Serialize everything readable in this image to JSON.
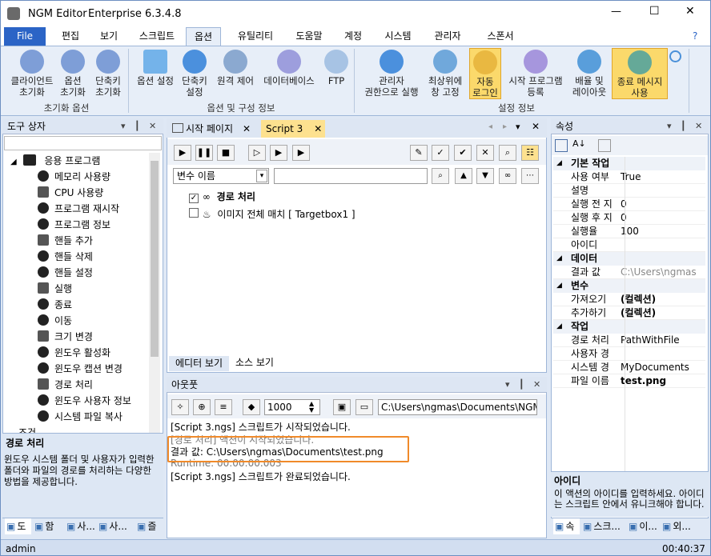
{
  "window": {
    "app_name": "NGM Editor",
    "edition": "Enterprise 6.3.4.8",
    "min": "—",
    "max": "☐",
    "close": "✕"
  },
  "menu": {
    "file": "File",
    "tabs": [
      "편집",
      "보기",
      "스크립트",
      "옵션",
      "유틸리티",
      "도움말",
      "계정",
      "시스템",
      "관리자",
      "스폰서"
    ]
  },
  "ribbon": {
    "init": [
      {
        "l1": "클라이언트",
        "l2": "초기화"
      },
      {
        "l1": "옵션",
        "l2": "초기화"
      },
      {
        "l1": "단축키",
        "l2": "초기화"
      }
    ],
    "options": [
      {
        "l1": "옵션 설정",
        "l2": ""
      },
      {
        "l1": "단축키",
        "l2": "설정"
      },
      {
        "l1": "원격 제어",
        "l2": ""
      },
      {
        "l1": "데이터베이스",
        "l2": ""
      },
      {
        "l1": "FTP",
        "l2": ""
      }
    ],
    "settings": [
      {
        "l1": "관리자",
        "l2": "권한으로 실행"
      },
      {
        "l1": "최상위에",
        "l2": "창 고정"
      },
      {
        "l1": "자동",
        "l2": "로그인"
      },
      {
        "l1": "시작 프로그램",
        "l2": "등록"
      },
      {
        "l1": "배율 및",
        "l2": "레이아웃"
      },
      {
        "l1": "종료 메시지",
        "l2": "사용"
      }
    ],
    "group_labels": [
      "초기화 옵션",
      "옵션 및 구성 정보",
      "설정 정보"
    ]
  },
  "toolbox": {
    "title": "도구 상자",
    "category": "응용 프로그램",
    "items": [
      "메모리 사용량",
      "CPU 사용량",
      "프로그램 재시작",
      "프로그램 정보",
      "핸들 추가",
      "핸들 삭제",
      "핸들 설정",
      "실행",
      "종료",
      "이동",
      "크기 변경",
      "윈도우 활성화",
      "윈도우 캡션 변경",
      "경로 처리",
      "윈도우 사용자 정보",
      "시스템 파일 복사"
    ],
    "partial_next": "조건",
    "desc_title": "경로 처리",
    "desc": "윈도우 시스템 폴더 및 사용자가 입력한 폴더와 파일의 경로를 처리하는 다양한 방법을 제공합니다.",
    "bottom_tabs": [
      "도",
      "함",
      "사...",
      "사...",
      "즐"
    ]
  },
  "editor": {
    "tabs": [
      "시작 페이지",
      "Script 3"
    ],
    "var_combo": "변수 이름",
    "actions": [
      {
        "title": "경로 처리",
        "checked": true
      },
      {
        "title": "이미지 전체 매치 [ Targetbox1 ]",
        "checked": false
      }
    ],
    "view_tabs": [
      "에디터 보기",
      "소스 보기"
    ]
  },
  "output": {
    "title": "아웃풋",
    "number": "1000",
    "path": "C:\\Users\\ngmas\\Documents\\NGM6\\",
    "lines": [
      "[Script 3.ngs] 스크립트가 시작되었습니다.",
      "[경로 처리] 액션이 시작되었습니다.",
      "결과 값: C:\\Users\\ngmas\\Documents\\test.png",
      "Runtime: 00:00:00.003",
      "[Script 3.ngs] 스크립트가 완료되었습니다."
    ]
  },
  "properties": {
    "title": "속성",
    "rows": [
      {
        "cat": "기본 작업"
      },
      {
        "k": "사용 여부",
        "v": "True"
      },
      {
        "k": "설명",
        "v": ""
      },
      {
        "k": "실행 전 지",
        "v": "0"
      },
      {
        "k": "실행 후 지",
        "v": "0"
      },
      {
        "k": "실행율",
        "v": "100"
      },
      {
        "k": "아이디",
        "v": ""
      },
      {
        "cat": "데이터"
      },
      {
        "k": "결과 값",
        "v": "C:\\Users\\ngmas"
      },
      {
        "cat": "변수"
      },
      {
        "k": "가져오기",
        "v": "(컬렉션)",
        "b": true
      },
      {
        "k": "추가하기",
        "v": "(컬렉션)",
        "b": true
      },
      {
        "cat": "작업"
      },
      {
        "k": "경로 처리",
        "v": "PathWithFile"
      },
      {
        "k": "사용자 경",
        "v": ""
      },
      {
        "k": "시스템 경",
        "v": "MyDocuments"
      },
      {
        "k": "파일 이름",
        "v": "test.png",
        "b": true
      }
    ],
    "desc_title": "아이디",
    "desc": "이 액션의 아이디를 입력하세요. 아이디는 스크립트 안에서 유니크해야 합니다.",
    "bottom_tabs": [
      "속",
      "스크...",
      "이...",
      "외..."
    ]
  },
  "status": {
    "user": "admin",
    "time": "00:40:37"
  }
}
